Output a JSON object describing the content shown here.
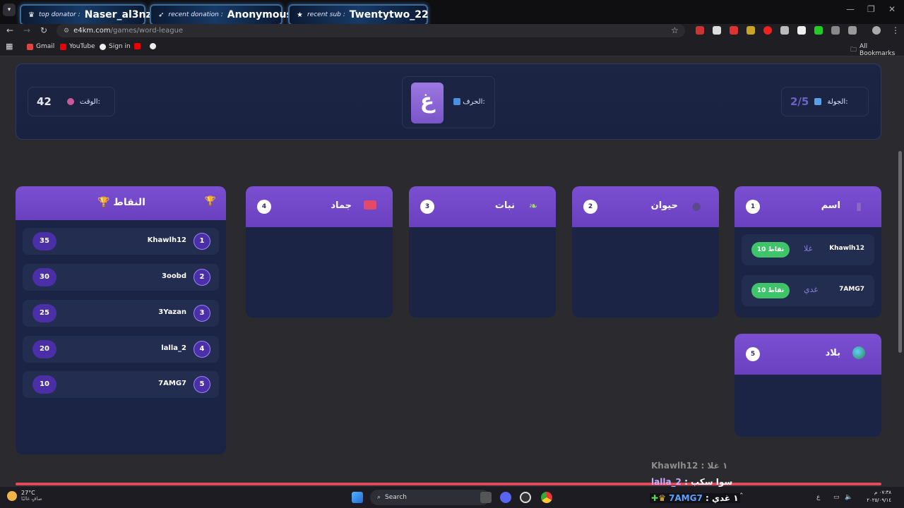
{
  "alerts": [
    {
      "icon": "crown",
      "label": "top donator :",
      "name": "Naser_al3nzy"
    },
    {
      "icon": "rocket",
      "label": "recent donation :",
      "name": "Anonymous"
    },
    {
      "icon": "star",
      "label": "recent sub :",
      "name": "Twentytwo_22"
    }
  ],
  "browser": {
    "host": "e4km.com",
    "path": "/games/word-league",
    "bookmarks": [
      "Gmail",
      "YouTube",
      "Sign in"
    ],
    "all_bookmarks": "All Bookmarks"
  },
  "game": {
    "round_label": "الجولة:",
    "round_value": "2/5",
    "letter_label": "الحرف:",
    "letter": "غ",
    "time_label": "الوقت:",
    "time_value": "42"
  },
  "categories": [
    {
      "num": "1",
      "title": "اسم",
      "icon": "person-icon",
      "answers": [
        {
          "user": "Khawlh12",
          "word": "غلا",
          "points": "10 نقاط"
        },
        {
          "user": "7AMG7",
          "word": "غدي",
          "points": "10 نقاط"
        }
      ]
    },
    {
      "num": "2",
      "title": "حيوان",
      "icon": "paw-icon",
      "answers": []
    },
    {
      "num": "3",
      "title": "نبات",
      "icon": "leaf-icon",
      "answers": []
    },
    {
      "num": "4",
      "title": "جماد",
      "icon": "toolbox-icon",
      "answers": []
    },
    {
      "num": "5",
      "title": "بلاد",
      "icon": "globe-icon",
      "answers": []
    }
  ],
  "leaderboard": {
    "title": "🏆 النقاط",
    "rows": [
      {
        "rank": "1",
        "name": "Khawlh12",
        "score": "35"
      },
      {
        "rank": "2",
        "name": "3oobd",
        "score": "30"
      },
      {
        "rank": "3",
        "name": "3Yazan",
        "score": "25"
      },
      {
        "rank": "4",
        "name": "lalla_2",
        "score": "20"
      },
      {
        "rank": "5",
        "name": "7AMG7",
        "score": "10"
      }
    ]
  },
  "chat": [
    {
      "text": "Khawlh12 : ١ غلا",
      "color": "#8d8d8d"
    },
    {
      "user": "lalla_2",
      "text": " : سوا سكب",
      "color": "#ffffff"
    },
    {
      "user": "7AMG7",
      "text": " : ١ غدي",
      "color": "#ffffff"
    }
  ],
  "taskbar": {
    "temp": "27°C",
    "weather": "صافٍ غالبًا",
    "search": "Search",
    "time": "٠٧:٣٨ م",
    "date": "٢٠٢٥/٠٩/١٤"
  }
}
